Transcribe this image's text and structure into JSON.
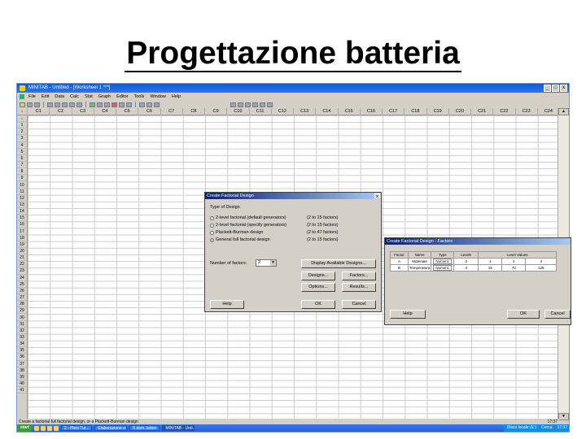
{
  "slide": {
    "title": "Progettazione batteria"
  },
  "window": {
    "title": "MINITAB - Untitled - [Worksheet 1 ***]",
    "controls": [
      "_",
      "□",
      "x"
    ]
  },
  "menu": [
    "File",
    "Edit",
    "Data",
    "Calc",
    "Stat",
    "Graph",
    "Editor",
    "Tools",
    "Window",
    "Help"
  ],
  "columns": [
    "↓",
    "C1",
    "C2",
    "C3",
    "C4",
    "C5",
    "C6",
    "C7",
    "C8",
    "C9",
    "C10",
    "C11",
    "C12",
    "C13",
    "C14",
    "C15",
    "C16",
    "C17",
    "C18",
    "C19",
    "C20",
    "C21",
    "C22",
    "C23",
    "C24"
  ],
  "rows": [
    "↓",
    "1",
    "2",
    "3",
    "4",
    "5",
    "6",
    "7",
    "8",
    "9",
    "10",
    "11",
    "12",
    "13",
    "14",
    "15",
    "16",
    "17",
    "18",
    "19",
    "20",
    "21",
    "22",
    "23",
    "24",
    "25",
    "26",
    "27",
    "28",
    "29",
    "30",
    "31",
    "32",
    "33",
    "34",
    "35",
    "36",
    "37",
    "38",
    "39",
    "40",
    "41"
  ],
  "status": {
    "left": "Create a factorial full factorial design, or a Plackett-Burman design",
    "clock": "17:37"
  },
  "dialog1": {
    "title": "Create Factorial Design",
    "type_label": "Type of Design",
    "options": [
      {
        "label": "2-level factorial (default generators)",
        "range": "(2 to 15 factors)",
        "selected": false
      },
      {
        "label": "2-level factorial (specify generators)",
        "range": "(2 to 15 factors)",
        "selected": false
      },
      {
        "label": "Plackett-Burman design",
        "range": "(2 to 47 factors)",
        "selected": false
      },
      {
        "label": "General full factorial design",
        "range": "(2 to 15 factors)",
        "selected": true
      }
    ],
    "num_factors_label": "Number of factors:",
    "num_factors_value": "2",
    "display_btn": "Display Available Designs...",
    "designs_btn": "Designs...",
    "factors_btn": "Factors...",
    "options_btn": "Options...",
    "results_btn": "Results...",
    "help_btn": "Help",
    "ok_btn": "OK",
    "cancel_btn": "Cancel"
  },
  "dialog2": {
    "title": "Create Factorial Design - Factors",
    "headers": [
      "Factor",
      "Name",
      "Type",
      "Levels",
      "Level Values"
    ],
    "rows": [
      {
        "factor": "A",
        "name": "Materiale",
        "type": "Numeric",
        "levels": "3",
        "values": [
          "1",
          "2",
          "3"
        ]
      },
      {
        "factor": "B",
        "name": "Temperatura",
        "type": "Numeric",
        "levels": "3",
        "values": [
          "15",
          "70",
          "125"
        ]
      }
    ],
    "help_btn": "Help",
    "ok_btn": "OK",
    "cancel_btn": "Cancel"
  },
  "taskbar": {
    "start": "start",
    "tasks": [
      "2 - Plesi Tut...",
      "Elaborazione vi...",
      "5 dom. lettori",
      "MINITAB - Unti..."
    ],
    "tray": [
      "Disco locale (E:)",
      "Cerca",
      "17:37"
    ]
  }
}
